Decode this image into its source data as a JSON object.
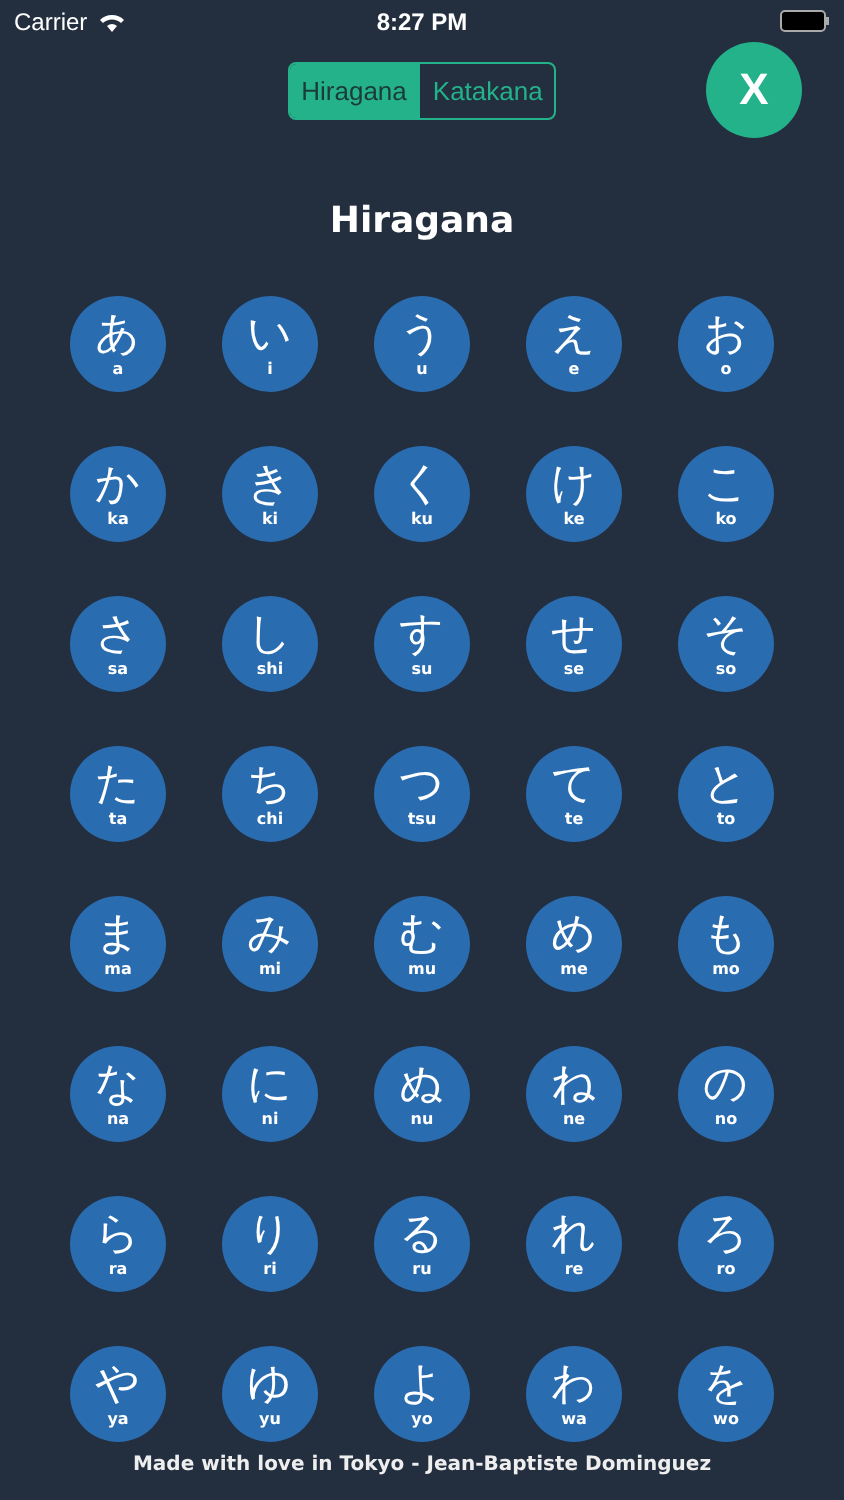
{
  "status_bar": {
    "carrier": "Carrier",
    "time": "8:27 PM"
  },
  "tabs": [
    {
      "label": "Hiragana",
      "selected": true
    },
    {
      "label": "Katakana",
      "selected": false
    }
  ],
  "close_button": {
    "label": "X"
  },
  "title": "Hiragana",
  "kana": [
    {
      "char": "あ",
      "romaji": "a"
    },
    {
      "char": "い",
      "romaji": "i"
    },
    {
      "char": "う",
      "romaji": "u"
    },
    {
      "char": "え",
      "romaji": "e"
    },
    {
      "char": "お",
      "romaji": "o"
    },
    {
      "char": "か",
      "romaji": "ka"
    },
    {
      "char": "き",
      "romaji": "ki"
    },
    {
      "char": "く",
      "romaji": "ku"
    },
    {
      "char": "け",
      "romaji": "ke"
    },
    {
      "char": "こ",
      "romaji": "ko"
    },
    {
      "char": "さ",
      "romaji": "sa"
    },
    {
      "char": "し",
      "romaji": "shi"
    },
    {
      "char": "す",
      "romaji": "su"
    },
    {
      "char": "せ",
      "romaji": "se"
    },
    {
      "char": "そ",
      "romaji": "so"
    },
    {
      "char": "た",
      "romaji": "ta"
    },
    {
      "char": "ち",
      "romaji": "chi"
    },
    {
      "char": "つ",
      "romaji": "tsu"
    },
    {
      "char": "て",
      "romaji": "te"
    },
    {
      "char": "と",
      "romaji": "to"
    },
    {
      "char": "ま",
      "romaji": "ma"
    },
    {
      "char": "み",
      "romaji": "mi"
    },
    {
      "char": "む",
      "romaji": "mu"
    },
    {
      "char": "め",
      "romaji": "me"
    },
    {
      "char": "も",
      "romaji": "mo"
    },
    {
      "char": "な",
      "romaji": "na"
    },
    {
      "char": "に",
      "romaji": "ni"
    },
    {
      "char": "ぬ",
      "romaji": "nu"
    },
    {
      "char": "ね",
      "romaji": "ne"
    },
    {
      "char": "の",
      "romaji": "no"
    },
    {
      "char": "ら",
      "romaji": "ra"
    },
    {
      "char": "り",
      "romaji": "ri"
    },
    {
      "char": "る",
      "romaji": "ru"
    },
    {
      "char": "れ",
      "romaji": "re"
    },
    {
      "char": "ろ",
      "romaji": "ro"
    },
    {
      "char": "や",
      "romaji": "ya"
    },
    {
      "char": "ゆ",
      "romaji": "yu"
    },
    {
      "char": "よ",
      "romaji": "yo"
    },
    {
      "char": "わ",
      "romaji": "wa"
    },
    {
      "char": "を",
      "romaji": "wo"
    }
  ],
  "footer": "Made with love in Tokyo - Jean-Baptiste Dominguez"
}
